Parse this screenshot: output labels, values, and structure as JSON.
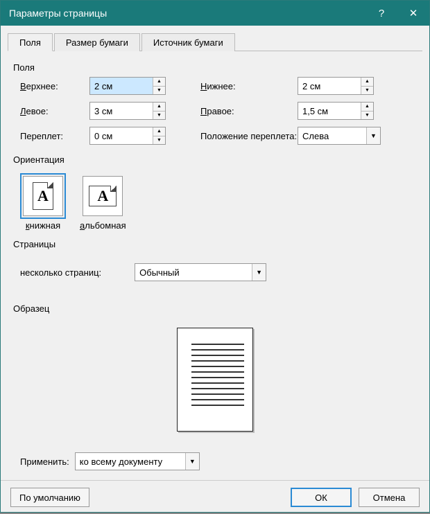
{
  "window": {
    "title": "Параметры страницы"
  },
  "tabs": {
    "fields": "Поля",
    "paper_size": "Размер бумаги",
    "paper_source": "Источник бумаги"
  },
  "margins": {
    "group_label": "Поля",
    "top_label": "Верхнее:",
    "top_value": "2 см",
    "bottom_label": "Нижнее:",
    "bottom_value": "2 см",
    "left_label": "Левое:",
    "left_value": "3 см",
    "right_label": "Правое:",
    "right_value": "1,5 см",
    "gutter_label": "Переплет:",
    "gutter_value": "0 см",
    "gutter_pos_label": "Положение переплета:",
    "gutter_pos_value": "Слева"
  },
  "orientation": {
    "group_label": "Ориентация",
    "portrait_label": "книжная",
    "landscape_label": "альбомная",
    "glyph": "A"
  },
  "pages": {
    "group_label": "Страницы",
    "multi_label": "несколько страниц:",
    "multi_value": "Обычный"
  },
  "preview": {
    "group_label": "Образец"
  },
  "apply": {
    "label": "Применить:",
    "value": "ко всему документу"
  },
  "footer": {
    "default_btn": "По умолчанию",
    "ok": "ОК",
    "cancel": "Отмена"
  }
}
